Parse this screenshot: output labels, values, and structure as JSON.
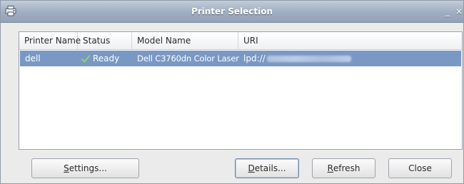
{
  "window": {
    "title": "Printer Selection",
    "minimize_glyph": "_",
    "close_glyph": "×",
    "app_icon": "printer-icon"
  },
  "table": {
    "columns": [
      "Printer Name",
      "Status",
      "Model Name",
      "URI"
    ],
    "rows": [
      {
        "name": "dell",
        "status": "Ready",
        "status_icon": "checkmark-icon",
        "model": "Dell C3760dn Color Laser",
        "uri": "lpd://",
        "selected": true
      }
    ]
  },
  "buttons": {
    "settings": {
      "mnemonic": "S",
      "rest": "ettings..."
    },
    "details": {
      "mnemonic": "D",
      "rest": "etails..."
    },
    "refresh": {
      "mnemonic": "R",
      "rest": "efresh"
    },
    "close": {
      "label": "Close"
    }
  },
  "colors": {
    "selection": "#7a98c4",
    "titlebar": "#9fadc1",
    "check": "#5fae3c"
  }
}
